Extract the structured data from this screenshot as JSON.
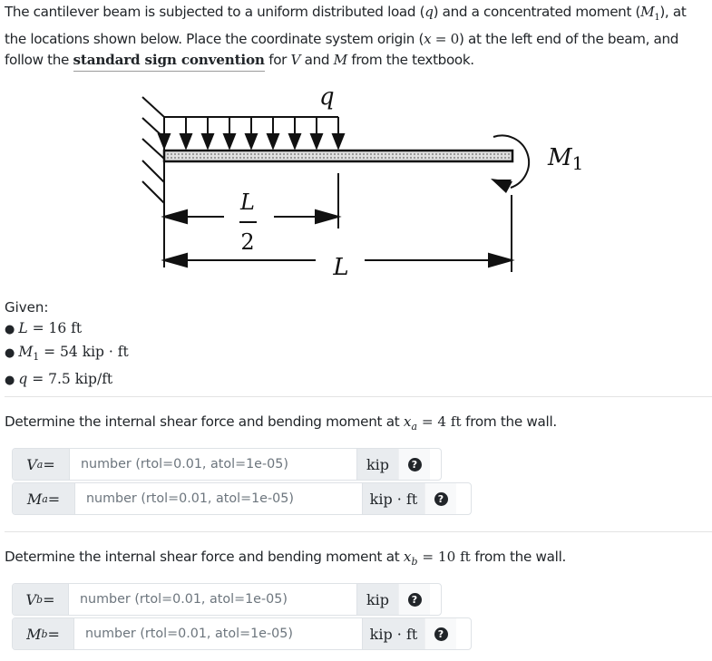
{
  "intro": {
    "part1": "The cantilever beam is subjected to a uniform distributed load (",
    "q_symbol": "q",
    "part2": ") and a concentrated moment (",
    "m1_symbol": "M",
    "m1_sub": "1",
    "part3": "), at the locations shown below. Place the coordinate system origin (",
    "origin_expr": "x",
    "origin_eq": " = 0",
    "part4": ") at the left end of the beam, and follow the ",
    "link_text": "standard sign convention",
    "part5": " for ",
    "v_symbol": "V",
    "part6": " and ",
    "m_symbol": "M",
    "part7": " from the textbook."
  },
  "figure": {
    "q_label": "q",
    "m1_label": "M",
    "m1_sub": "1",
    "half_num": "L",
    "half_den": "2",
    "full_label": "L"
  },
  "given": {
    "label": "Given:",
    "items": [
      {
        "sym": "L",
        "sub": "",
        "value": " = 16 ft"
      },
      {
        "sym": "M",
        "sub": "1",
        "value": " = 54 kip · ft"
      },
      {
        "sym": "q",
        "sub": "",
        "value": " = 7.5 kip/ft"
      }
    ]
  },
  "questions": [
    {
      "text_before": "Determine the internal shear force and bending moment at ",
      "x_sym": "x",
      "x_sub": "a",
      "x_value": " = 4 ft",
      "text_after": " from the wall.",
      "inputs": [
        {
          "sym": "V",
          "sub": "a",
          "eq": " =",
          "placeholder": "number (rtol=0.01, atol=1e-05)",
          "value": "",
          "unit": "kip",
          "help": "?"
        },
        {
          "sym": "M",
          "sub": "a",
          "eq": " =",
          "placeholder": "number (rtol=0.01, atol=1e-05)",
          "value": "",
          "unit": "kip · ft",
          "help": "?"
        }
      ]
    },
    {
      "text_before": "Determine the internal shear force and bending moment at ",
      "x_sym": "x",
      "x_sub": "b",
      "x_value": " = 10 ft",
      "text_after": " from the wall.",
      "inputs": [
        {
          "sym": "V",
          "sub": "b",
          "eq": " =",
          "placeholder": "number (rtol=0.01, atol=1e-05)",
          "value": "",
          "unit": "kip",
          "help": "?"
        },
        {
          "sym": "M",
          "sub": "b",
          "eq": " =",
          "placeholder": "number (rtol=0.01, atol=1e-05)",
          "value": "",
          "unit": "kip · ft",
          "help": "?"
        }
      ]
    }
  ]
}
